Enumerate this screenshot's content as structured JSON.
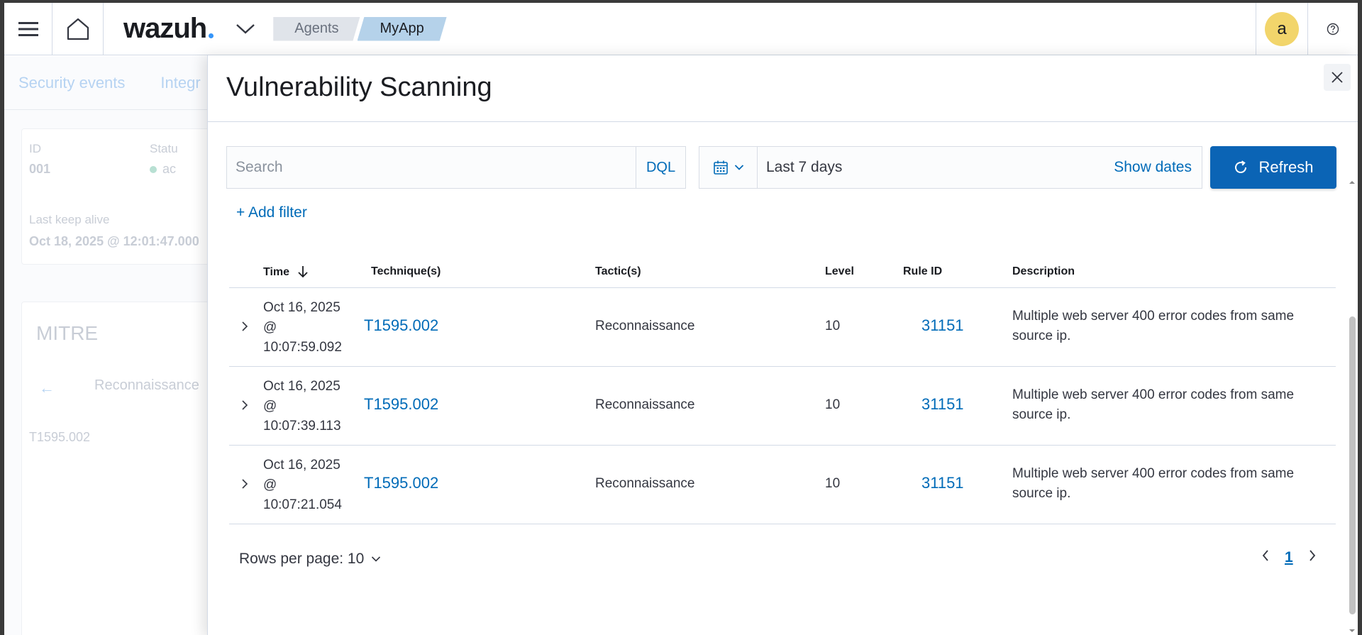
{
  "header": {
    "logo_text": "wazuh",
    "breadcrumbs": [
      "Agents",
      "MyApp"
    ],
    "avatar_letter": "a"
  },
  "background": {
    "tabs": [
      "Security events",
      "Integr"
    ],
    "id_label": "ID",
    "id_value": "001",
    "status_label": "Statu",
    "status_value": "ac",
    "keepalive_label": "Last keep alive",
    "keepalive_value": "Oct 18, 2025 @ 12:01:47.000",
    "mitre_title": "MITRE",
    "mitre_tactic": "Reconnaissance",
    "mitre_technique": "T1595.002"
  },
  "flyout": {
    "title": "Vulnerability Scanning",
    "search_placeholder": "Search",
    "dql_label": "DQL",
    "date_range": "Last 7 days",
    "show_dates_label": "Show dates",
    "refresh_label": "Refresh",
    "add_filter_label": "+ Add filter"
  },
  "table": {
    "columns": {
      "time": "Time",
      "technique": "Technique(s)",
      "tactic": "Tactic(s)",
      "level": "Level",
      "rule_id": "Rule ID",
      "description": "Description"
    },
    "rows": [
      {
        "date": "Oct 16, 2025",
        "at": "@",
        "clock": "10:07:59.092",
        "technique": "T1595.002",
        "tactic": "Reconnaissance",
        "level": "10",
        "rule_id": "31151",
        "description": "Multiple web server 400 error codes from same source ip."
      },
      {
        "date": "Oct 16, 2025",
        "at": "@",
        "clock": "10:07:39.113",
        "technique": "T1595.002",
        "tactic": "Reconnaissance",
        "level": "10",
        "rule_id": "31151",
        "description": "Multiple web server 400 error codes from same source ip."
      },
      {
        "date": "Oct 16, 2025",
        "at": "@",
        "clock": "10:07:21.054",
        "technique": "T1595.002",
        "tactic": "Reconnaissance",
        "level": "10",
        "rule_id": "31151",
        "description": "Multiple web server 400 error codes from same source ip."
      }
    ]
  },
  "pagination": {
    "rows_per_page_label": "Rows per page: 10",
    "current_page": "1"
  },
  "colors": {
    "accent": "#006bb8",
    "primary_button": "#0b64b5",
    "avatar": "#f2d56b",
    "breadcrumb_active": "#b5d2ea"
  }
}
